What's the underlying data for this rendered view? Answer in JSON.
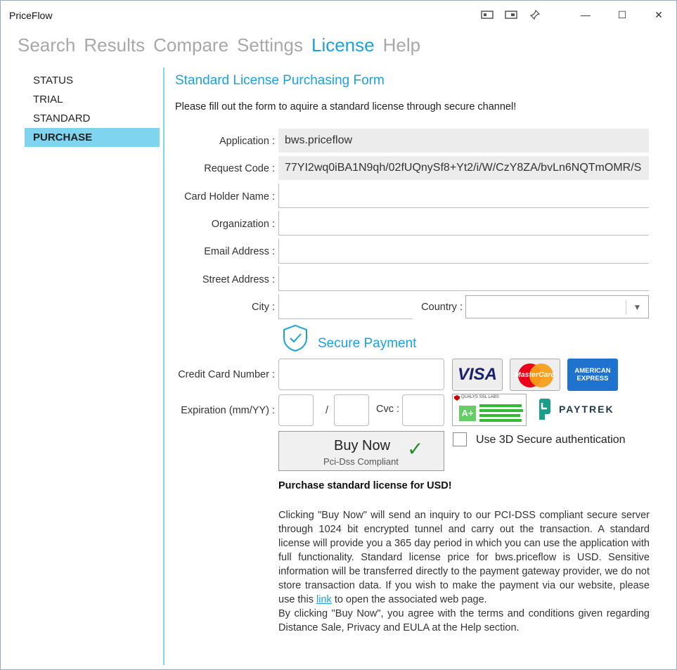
{
  "window": {
    "title": "PriceFlow",
    "controls": {
      "minimize": "—",
      "maximize": "☐",
      "close": "✕"
    }
  },
  "nav": {
    "items": [
      "Search",
      "Results",
      "Compare",
      "Settings",
      "License",
      "Help"
    ],
    "active": "License"
  },
  "sidebar": {
    "items": [
      "STATUS",
      "TRIAL",
      "STANDARD",
      "PURCHASE"
    ],
    "active": "PURCHASE"
  },
  "form": {
    "title": "Standard License Purchasing Form",
    "subtitle": "Please fill out the form to aquire a standard license through secure channel!",
    "application_label": "Application :",
    "application_value": "bws.priceflow",
    "request_code_label": "Request Code :",
    "request_code_value": "77YI2wq0iBA1N9qh/02fUQnySf8+Yt2/i/W/CzY8ZA/bvLn6NQTmOMR/S",
    "card_holder_label": "Card Holder Name :",
    "organization_label": "Organization :",
    "email_label": "Email Address :",
    "street_label": "Street Address :",
    "city_label": "City :",
    "country_label": "Country :",
    "secure_payment": "Secure Payment",
    "cc_label": "Credit Card Number :",
    "exp_label": "Expiration (mm/YY) :",
    "exp_sep": "/",
    "cvc_label": "Cvc :",
    "buy_main": "Buy Now",
    "buy_sub": "Pci-Dss Compliant",
    "secure3d_label": "Use 3D Secure authentication",
    "purchase_text": "Purchase standard license for  USD!",
    "para_1": "Clicking \"Buy Now\" will send an inquiry to our PCI-DSS compliant secure server through 1024 bit encrypted tunnel and carry out the transaction. A standard license will provide you a 365 day period in which you can use the application with full functionality. Standard license price for bws.priceflow is  USD. Sensitive information will be transferred directly to the payment gateway provider, we do not store transaction data. If you wish to make the payment via our website, please use this",
    "link_text": "link",
    "para_2": "to open the associated web page.",
    "para_3": "By clicking \"Buy Now\", you agree with the terms and conditions given regarding Distance Sale, Privacy and EULA at the Help section."
  },
  "logos": {
    "visa": "VISA",
    "mastercard": "MasterCard",
    "amex_1": "AMERICAN",
    "amex_2": "EXPRESS",
    "ssl_title": "QUALYS SSL LABS",
    "ssl_grade": "A+",
    "paytrek": "PAYTREK"
  },
  "colors": {
    "accent": "#1ba1e2",
    "sidebar_active": "#7fd4f0"
  }
}
